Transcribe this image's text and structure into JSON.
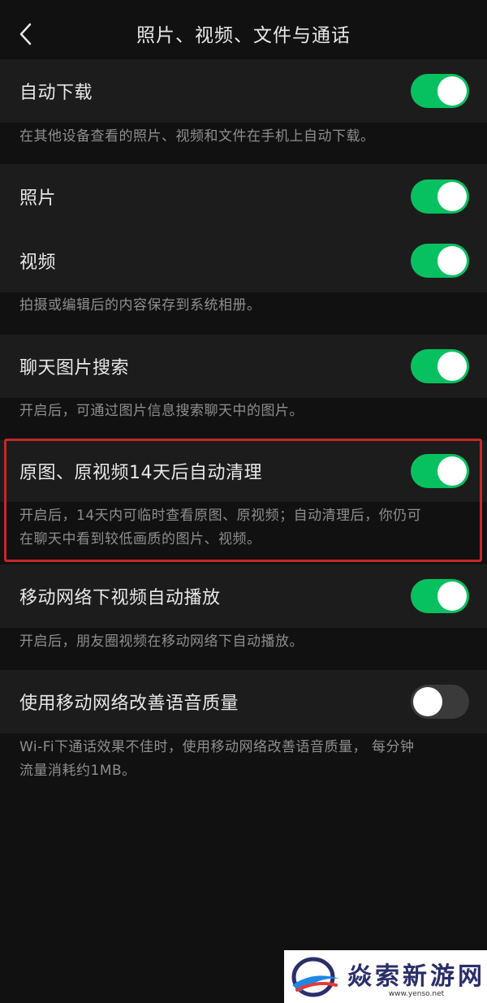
{
  "header": {
    "title": "照片、视频、文件与通话"
  },
  "settings": {
    "auto_download": {
      "label": "自动下载",
      "on": true,
      "desc": "在其他设备查看的照片、视频和文件在手机上自动下载。"
    },
    "photos": {
      "label": "照片",
      "on": true
    },
    "videos": {
      "label": "视频",
      "on": true,
      "desc": "拍摄或编辑后的内容保存到系统相册。"
    },
    "chat_image_search": {
      "label": "聊天图片搜索",
      "on": true,
      "desc": "开启后，可通过图片信息搜索聊天中的图片。"
    },
    "auto_cleanup": {
      "label": "原图、原视频14天后自动清理",
      "on": true,
      "desc_line1": "开启后，14天内可临时查看原图、原视频；自动清理后，你仍可",
      "desc_line2": "在聊天中看到较低画质的图片、视频。"
    },
    "mobile_autoplay": {
      "label": "移动网络下视频自动播放",
      "on": true,
      "desc": "开启后，朋友圈视频在移动网络下自动播放。"
    },
    "voice_quality": {
      "label": "使用移动网络改善语音质量",
      "on": false,
      "desc_line1": "Wi-Fi下通话效果不佳时，使用移动网络改善语音质量， 每分钟",
      "desc_line2": "流量消耗约1MB。"
    }
  },
  "watermark": {
    "name": "焱索新游网",
    "url": "www.yenso.net"
  },
  "colors": {
    "toggle_on": "#07c160",
    "toggle_off": "#3a3a3a",
    "highlight_border": "#c62828",
    "background": "#111111",
    "row_background": "#1c1c1c"
  }
}
